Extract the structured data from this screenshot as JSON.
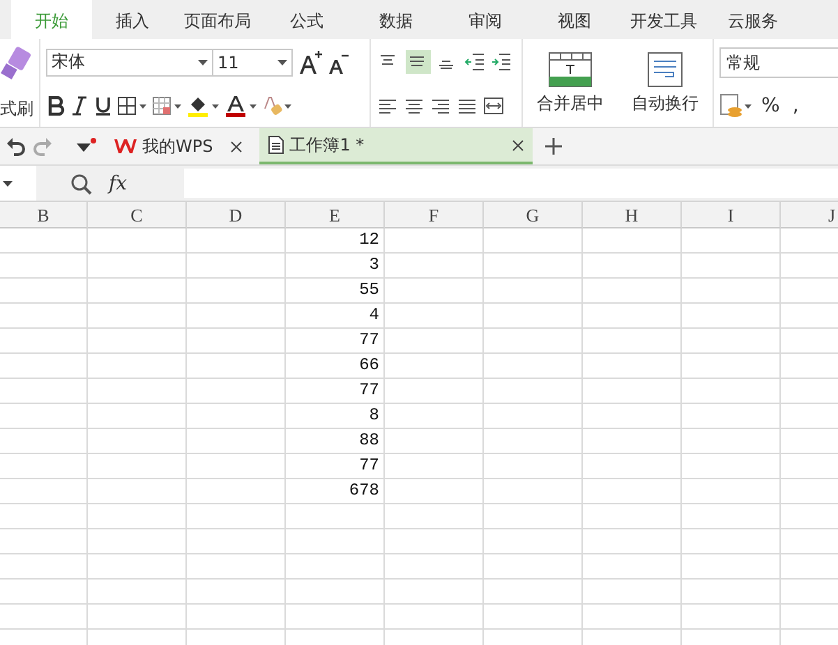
{
  "menu_tabs": [
    {
      "label": "开始",
      "selected": true
    },
    {
      "label": "插入",
      "selected": false
    },
    {
      "label": "页面布局",
      "selected": false
    },
    {
      "label": "公式",
      "selected": false
    },
    {
      "label": "数据",
      "selected": false
    },
    {
      "label": "审阅",
      "selected": false
    },
    {
      "label": "视图",
      "selected": false
    },
    {
      "label": "开发工具",
      "selected": false
    },
    {
      "label": "云服务",
      "selected": false
    }
  ],
  "ribbon": {
    "format_painter": "式刷",
    "font": "宋体",
    "font_size": "11",
    "align_top": [
      {
        "kind": "top",
        "selected": false
      },
      {
        "kind": "middle",
        "selected": true
      },
      {
        "kind": "bottom",
        "selected": false
      }
    ],
    "merge": "合并居中",
    "wrap": "自动换行",
    "number_format": "常规",
    "percent": "%",
    "comma": ","
  },
  "doc_tabs": [
    {
      "label": "我的WPS",
      "kind": "home",
      "selected": false
    },
    {
      "label": "工作簿1 *",
      "kind": "sheet",
      "selected": true
    }
  ],
  "formula_bar": {
    "fx": "fx"
  },
  "columns": [
    "B",
    "C",
    "D",
    "E",
    "F",
    "G",
    "H",
    "I",
    "J"
  ],
  "column_e": [
    "12",
    "3",
    "55",
    "4",
    "77",
    "66",
    "77",
    "8",
    "88",
    "77",
    "678"
  ]
}
